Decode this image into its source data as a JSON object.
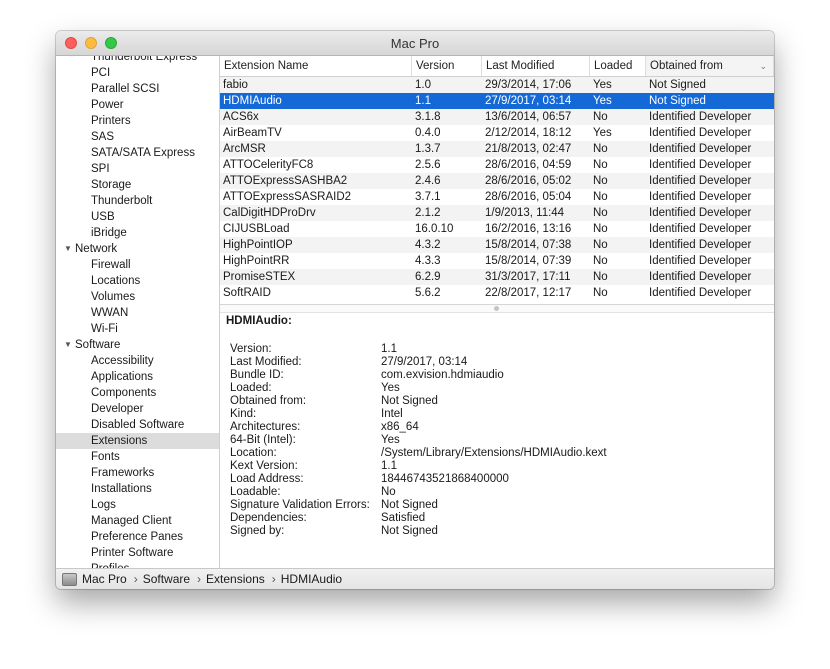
{
  "window": {
    "title": "Mac Pro"
  },
  "sidebar": {
    "items": [
      {
        "label": "Thunderbolt Express",
        "level": 1
      },
      {
        "label": "PCI",
        "level": 1
      },
      {
        "label": "Parallel SCSI",
        "level": 1
      },
      {
        "label": "Power",
        "level": 1
      },
      {
        "label": "Printers",
        "level": 1
      },
      {
        "label": "SAS",
        "level": 1
      },
      {
        "label": "SATA/SATA Express",
        "level": 1
      },
      {
        "label": "SPI",
        "level": 1
      },
      {
        "label": "Storage",
        "level": 1
      },
      {
        "label": "Thunderbolt",
        "level": 1
      },
      {
        "label": "USB",
        "level": 1
      },
      {
        "label": "iBridge",
        "level": 1
      },
      {
        "label": "Network",
        "level": 0
      },
      {
        "label": "Firewall",
        "level": 1
      },
      {
        "label": "Locations",
        "level": 1
      },
      {
        "label": "Volumes",
        "level": 1
      },
      {
        "label": "WWAN",
        "level": 1
      },
      {
        "label": "Wi-Fi",
        "level": 1
      },
      {
        "label": "Software",
        "level": 0
      },
      {
        "label": "Accessibility",
        "level": 1
      },
      {
        "label": "Applications",
        "level": 1
      },
      {
        "label": "Components",
        "level": 1
      },
      {
        "label": "Developer",
        "level": 1
      },
      {
        "label": "Disabled Software",
        "level": 1
      },
      {
        "label": "Extensions",
        "level": 1,
        "selected": true
      },
      {
        "label": "Fonts",
        "level": 1
      },
      {
        "label": "Frameworks",
        "level": 1
      },
      {
        "label": "Installations",
        "level": 1
      },
      {
        "label": "Logs",
        "level": 1
      },
      {
        "label": "Managed Client",
        "level": 1
      },
      {
        "label": "Preference Panes",
        "level": 1
      },
      {
        "label": "Printer Software",
        "level": 1
      },
      {
        "label": "Profiles",
        "level": 1
      }
    ],
    "expand_glyph": "▼"
  },
  "table": {
    "columns": [
      "Extension Name",
      "Version",
      "Last Modified",
      "Loaded",
      "Obtained from"
    ],
    "sort_icon": "chevron-down-icon",
    "sort_glyph": "⌄",
    "selected_index": 1,
    "rows": [
      [
        "fabio",
        "1.0",
        "29/3/2014, 17:06",
        "Yes",
        "Not Signed"
      ],
      [
        "HDMIAudio",
        "1.1",
        "27/9/2017, 03:14",
        "Yes",
        "Not Signed"
      ],
      [
        "ACS6x",
        "3.1.8",
        "13/6/2014, 06:57",
        "No",
        "Identified Developer"
      ],
      [
        "AirBeamTV",
        "0.4.0",
        "2/12/2014, 18:12",
        "Yes",
        "Identified Developer"
      ],
      [
        "ArcMSR",
        "1.3.7",
        "21/8/2013, 02:47",
        "No",
        "Identified Developer"
      ],
      [
        "ATTOCelerityFC8",
        "2.5.6",
        "28/6/2016, 04:59",
        "No",
        "Identified Developer"
      ],
      [
        "ATTOExpressSASHBA2",
        "2.4.6",
        "28/6/2016, 05:02",
        "No",
        "Identified Developer"
      ],
      [
        "ATTOExpressSASRAID2",
        "3.7.1",
        "28/6/2016, 05:04",
        "No",
        "Identified Developer"
      ],
      [
        "CalDigitHDProDrv",
        "2.1.2",
        "1/9/2013, 11:44",
        "No",
        "Identified Developer"
      ],
      [
        "CIJUSBLoad",
        "16.0.10",
        "16/2/2016, 13:16",
        "No",
        "Identified Developer"
      ],
      [
        "HighPointIOP",
        "4.3.2",
        "15/8/2014, 07:38",
        "No",
        "Identified Developer"
      ],
      [
        "HighPointRR",
        "4.3.3",
        "15/8/2014, 07:39",
        "No",
        "Identified Developer"
      ],
      [
        "PromiseSTEX",
        "6.2.9",
        "31/3/2017, 17:11",
        "No",
        "Identified Developer"
      ],
      [
        "SoftRAID",
        "5.6.2",
        "22/8/2017, 12:17",
        "No",
        "Identified Developer"
      ]
    ]
  },
  "detail": {
    "title": "HDMIAudio:",
    "fields": [
      {
        "label": "Version:",
        "value": "1.1"
      },
      {
        "label": "Last Modified:",
        "value": "27/9/2017, 03:14"
      },
      {
        "label": "Bundle ID:",
        "value": "com.exvision.hdmiaudio"
      },
      {
        "label": "Loaded:",
        "value": "Yes"
      },
      {
        "label": "Obtained from:",
        "value": "Not Signed"
      },
      {
        "label": "Kind:",
        "value": "Intel"
      },
      {
        "label": "Architectures:",
        "value": "x86_64"
      },
      {
        "label": "64-Bit (Intel):",
        "value": "Yes"
      },
      {
        "label": "Location:",
        "value": "/System/Library/Extensions/HDMIAudio.kext"
      },
      {
        "label": "Kext Version:",
        "value": "1.1"
      },
      {
        "label": "Load Address:",
        "value": "18446743521868400000"
      },
      {
        "label": "Loadable:",
        "value": "No"
      },
      {
        "label": "Signature Validation Errors:",
        "value": "Not Signed"
      },
      {
        "label": "Dependencies:",
        "value": "Satisfied"
      },
      {
        "label": "Signed by:",
        "value": "Not Signed"
      }
    ]
  },
  "statusbar": {
    "icon": "mac-pro-icon",
    "separator": "›",
    "path": [
      "Mac Pro",
      "Software",
      "Extensions",
      "HDMIAudio"
    ]
  },
  "colors": {
    "selection": "#1569d6",
    "close": "#fc605c",
    "minimize": "#fdbc40",
    "zoom": "#34c84a"
  }
}
